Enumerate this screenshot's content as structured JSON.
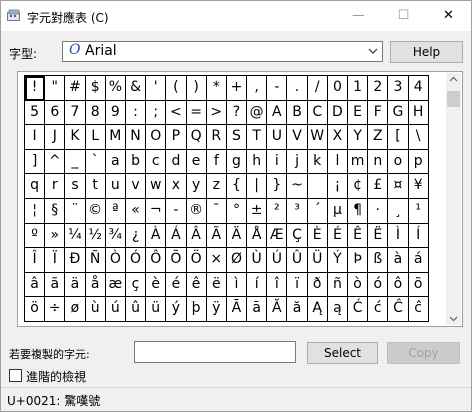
{
  "window": {
    "title": "字元對應表 (C)",
    "minimize": "—",
    "maximize": "☐",
    "close": "✕"
  },
  "font": {
    "label": "字型:",
    "name": "Arial",
    "icon": "O"
  },
  "help_button": "Help",
  "characters": [
    "!",
    "\"",
    "#",
    "$",
    "%",
    "&",
    "'",
    "(",
    ")",
    "*",
    "+",
    ",",
    "-",
    ".",
    "/",
    "0",
    "1",
    "2",
    "3",
    "4",
    "5",
    "6",
    "7",
    "8",
    "9",
    ":",
    ";",
    "<",
    "=",
    ">",
    "?",
    "@",
    "A",
    "B",
    "C",
    "D",
    "E",
    "F",
    "G",
    "H",
    "I",
    "J",
    "K",
    "L",
    "M",
    "N",
    "O",
    "P",
    "Q",
    "R",
    "S",
    "T",
    "U",
    "V",
    "W",
    "X",
    "Y",
    "Z",
    "[",
    "\\",
    "]",
    "^",
    "_",
    "`",
    "a",
    "b",
    "c",
    "d",
    "e",
    "f",
    "g",
    "h",
    "i",
    "j",
    "k",
    "l",
    "m",
    "n",
    "o",
    "p",
    "q",
    "r",
    "s",
    "t",
    "u",
    "v",
    "w",
    "x",
    "y",
    "z",
    "{",
    "|",
    "}",
    "~",
    " ",
    "¡",
    "¢",
    "£",
    "¤",
    "¥",
    "¦",
    "§",
    "¨",
    "©",
    "ª",
    "«",
    "¬",
    "-",
    "®",
    "¯",
    "°",
    "±",
    "²",
    "³",
    "´",
    "µ",
    "¶",
    "·",
    "¸",
    "¹",
    "º",
    "»",
    "¼",
    "½",
    "¾",
    "¿",
    "À",
    "Á",
    "Â",
    "Ã",
    "Ä",
    "Å",
    "Æ",
    "Ç",
    "È",
    "É",
    "Ê",
    "Ë",
    "Ì",
    "Í",
    "Î",
    "Ï",
    "Ð",
    "Ñ",
    "Ò",
    "Ó",
    "Ô",
    "Õ",
    "Ö",
    "×",
    "Ø",
    "Ù",
    "Ú",
    "Û",
    "Ü",
    "Ý",
    "Þ",
    "ß",
    "à",
    "á",
    "â",
    "ã",
    "ä",
    "å",
    "æ",
    "ç",
    "è",
    "é",
    "ê",
    "ë",
    "ì",
    "í",
    "î",
    "ï",
    "ð",
    "ñ",
    "ò",
    "ó",
    "ô",
    "õ",
    "ö",
    "÷",
    "ø",
    "ù",
    "ú",
    "û",
    "ü",
    "ý",
    "þ",
    "ÿ",
    "Ā",
    "ā",
    "Ă",
    "ă",
    "Ą",
    "ą",
    "Ć",
    "ć",
    "Ĉ",
    "ĉ"
  ],
  "selected_index": 0,
  "copy": {
    "label": "若要複製的字元:",
    "value": "",
    "select_button": "Select",
    "copy_button": "Copy"
  },
  "advanced_view": {
    "label": "進階的檢視",
    "checked": false
  },
  "status": {
    "text": "U+0021: 驚嘆號"
  },
  "icons": {
    "app": "charmap-icon",
    "dropdown": "chevron-down-icon",
    "scroll_up": "scroll-up-icon",
    "scroll_down": "scroll-down-icon"
  }
}
